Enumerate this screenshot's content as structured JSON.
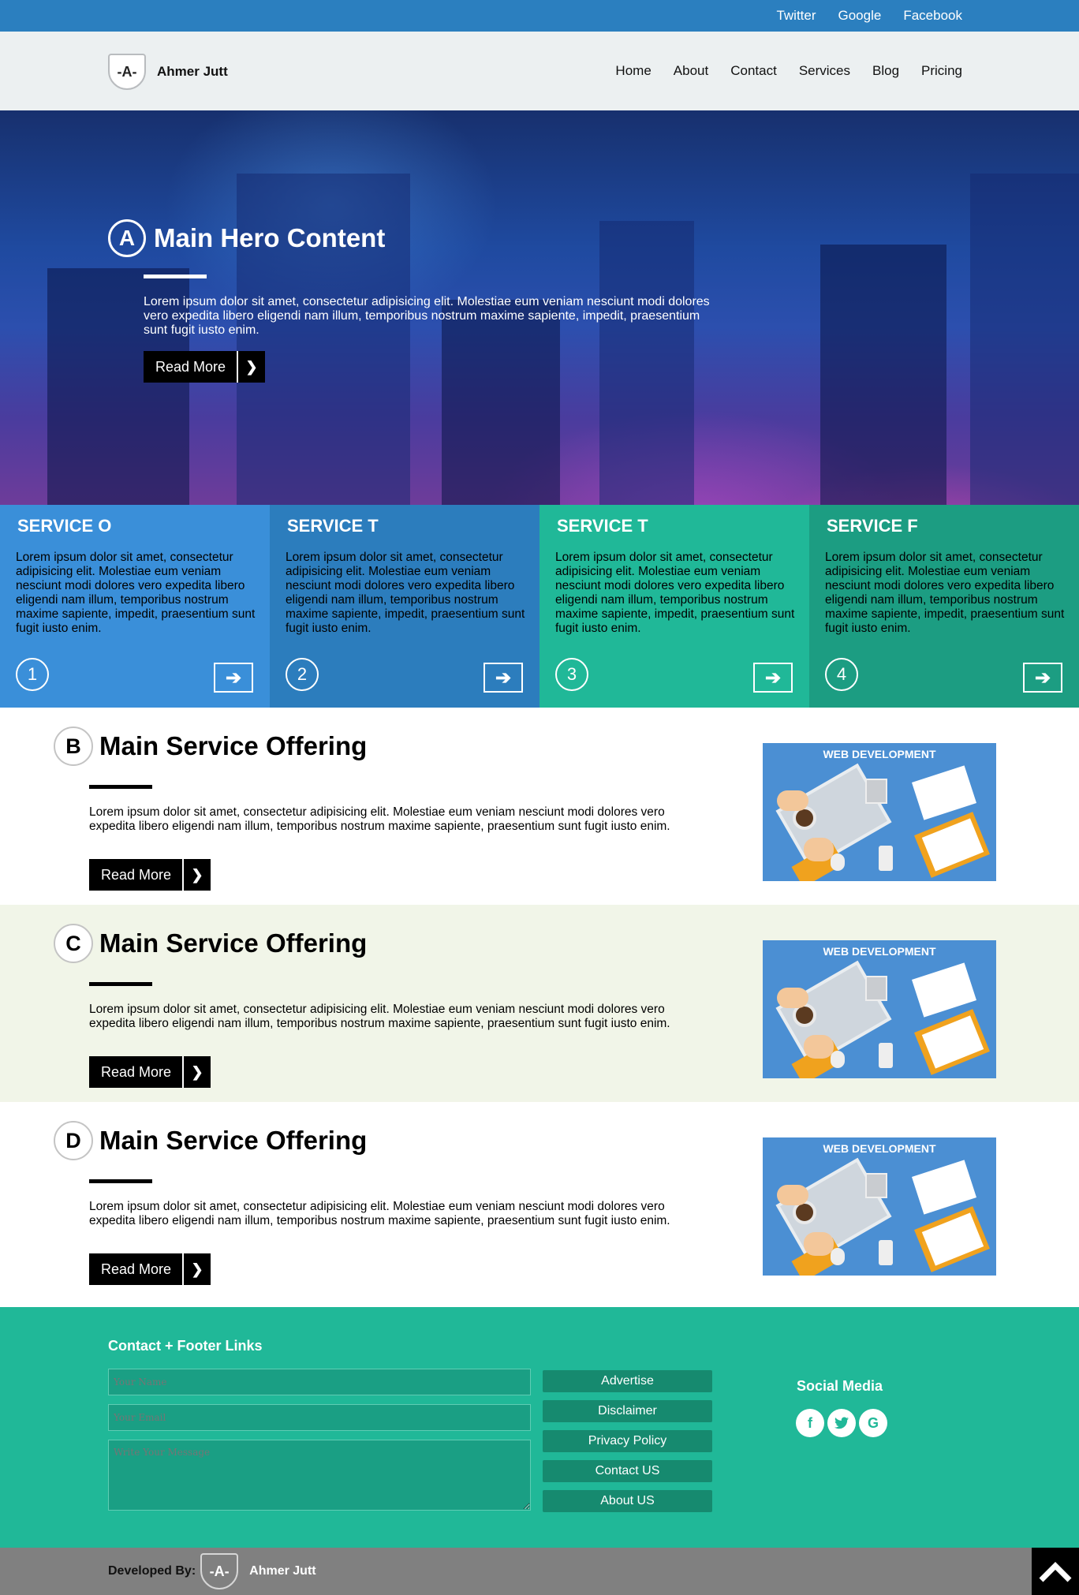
{
  "topbar": {
    "links": [
      "Twitter",
      "Google",
      "Facebook"
    ]
  },
  "header": {
    "logo_mark": "-A-",
    "brand": "Ahmer Jutt",
    "nav": [
      "Home",
      "About",
      "Contact",
      "Services",
      "Blog",
      "Pricing"
    ]
  },
  "hero": {
    "badge": "A",
    "title": "Main Hero Content",
    "text": "Lorem ipsum dolor sit amet, consectetur adipisicing elit. Molestiae eum veniam nesciunt modi dolores vero expedita libero eligendi nam illum, temporibus nostrum maxime sapiente, impedit, praesentium sunt fugit iusto enim.",
    "button": "Read More",
    "button_icon": "chevron-right-icon"
  },
  "services": [
    {
      "title": "SERVICE O",
      "text": "Lorem ipsum dolor sit amet, consectetur adipisicing elit. Molestiae eum veniam nesciunt modi dolores vero expedita libero eligendi nam illum, temporibus nostrum maxime sapiente, impedit, praesentium sunt fugit iusto enim.",
      "number": "1",
      "color": "#3a8fd9"
    },
    {
      "title": "SERVICE T",
      "text": "Lorem ipsum dolor sit amet, consectetur adipisicing elit. Molestiae eum veniam nesciunt modi dolores vero expedita libero eligendi nam illum, temporibus nostrum maxime sapiente, impedit, praesentium sunt fugit iusto enim.",
      "number": "2",
      "color": "#2c7dbd"
    },
    {
      "title": "SERVICE T",
      "text": "Lorem ipsum dolor sit amet, consectetur adipisicing elit. Molestiae eum veniam nesciunt modi dolores vero expedita libero eligendi nam illum, temporibus nostrum maxime sapiente, impedit, praesentium sunt fugit iusto enim.",
      "number": "3",
      "color": "#20b898"
    },
    {
      "title": "SERVICE F",
      "text": "Lorem ipsum dolor sit amet, consectetur adipisicing elit. Molestiae eum veniam nesciunt modi dolores vero expedita libero eligendi nam illum, temporibus nostrum maxime sapiente, impedit, praesentium sunt fugit iusto enim.",
      "number": "4",
      "color": "#1c9d82"
    }
  ],
  "offerings": [
    {
      "badge": "B",
      "title": "Main Service Offering",
      "text": "Lorem ipsum dolor sit amet, consectetur adipisicing elit. Molestiae eum veniam nesciunt modi dolores vero expedita libero eligendi nam illum, temporibus nostrum maxime sapiente, praesentium sunt fugit iusto enim.",
      "button": "Read More",
      "image_caption": "WEB DEVELOPMENT",
      "bg": "#ffffff"
    },
    {
      "badge": "C",
      "title": "Main Service Offering",
      "text": "Lorem ipsum dolor sit amet, consectetur adipisicing elit. Molestiae eum veniam nesciunt modi dolores vero expedita libero eligendi nam illum, temporibus nostrum maxime sapiente, praesentium sunt fugit iusto enim.",
      "button": "Read More",
      "image_caption": "WEB DEVELOPMENT",
      "bg": "#f1f5e8"
    },
    {
      "badge": "D",
      "title": "Main Service Offering",
      "text": "Lorem ipsum dolor sit amet, consectetur adipisicing elit. Molestiae eum veniam nesciunt modi dolores vero expedita libero eligendi nam illum, temporibus nostrum maxime sapiente, praesentium sunt fugit iusto enim.",
      "button": "Read More",
      "image_caption": "WEB DEVELOPMENT",
      "bg": "#ffffff"
    }
  ],
  "footer": {
    "title": "Contact + Footer Links",
    "name_placeholder": "Your Name",
    "email_placeholder": "Your Email",
    "message_placeholder": "Write Your Message",
    "links": [
      "Advertise",
      "Disclaimer",
      "Privacy Policy",
      "Contact US",
      "About US"
    ],
    "social_title": "Social Media",
    "social_icons": [
      "facebook-icon",
      "twitter-icon",
      "google-icon"
    ]
  },
  "bottom": {
    "developed_by": "Developed By:",
    "logo_mark": "-A-",
    "brand": "Ahmer Jutt",
    "to_top_icon": "chevron-up-icon"
  },
  "colors": {
    "topbar": "#2b7fbf",
    "header": "#ecf0f1",
    "footer": "#20b898",
    "bottom": "#808080"
  }
}
